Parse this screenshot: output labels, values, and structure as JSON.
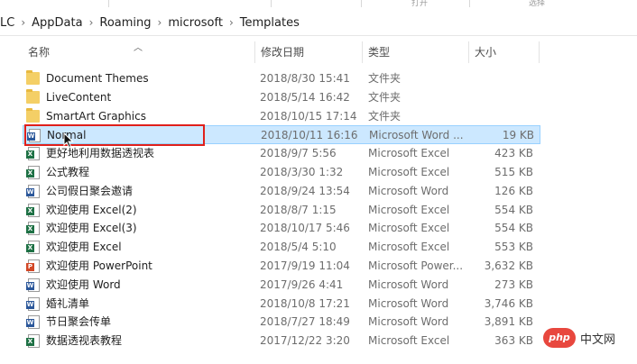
{
  "window": {
    "breadcrumb": [
      "LC",
      "AppData",
      "Roaming",
      "microsoft",
      "Templates"
    ]
  },
  "ribbon": {
    "labels": [
      "打开",
      "选择"
    ]
  },
  "columns": {
    "name": "名称",
    "date": "修改日期",
    "type": "类型",
    "size": "大小"
  },
  "files": [
    {
      "name": "Document Themes",
      "date": "2018/8/30 15:41",
      "type": "文件夹",
      "size": "",
      "icon": "folder-icon"
    },
    {
      "name": "LiveContent",
      "date": "2018/5/14 16:42",
      "type": "文件夹",
      "size": "",
      "icon": "folder-icon"
    },
    {
      "name": "SmartArt Graphics",
      "date": "2018/10/15 17:14",
      "type": "文件夹",
      "size": "",
      "icon": "folder-icon"
    },
    {
      "name": "Normal",
      "date": "2018/10/11 16:16",
      "type": "Microsoft Word ...",
      "size": "19 KB",
      "icon": "word-file-icon"
    },
    {
      "name": "更好地利用数据透视表",
      "date": "2018/9/7 5:56",
      "type": "Microsoft Excel",
      "size": "423 KB",
      "icon": "excel-file-icon"
    },
    {
      "name": "公式教程",
      "date": "2018/3/30 1:32",
      "type": "Microsoft Excel",
      "size": "515 KB",
      "icon": "excel-file-icon"
    },
    {
      "name": "公司假日聚会邀请",
      "date": "2018/9/24 13:54",
      "type": "Microsoft Word",
      "size": "126 KB",
      "icon": "word-file-icon"
    },
    {
      "name": "欢迎使用 Excel(2)",
      "date": "2018/8/7 1:15",
      "type": "Microsoft Excel",
      "size": "554 KB",
      "icon": "excel-file-icon"
    },
    {
      "name": "欢迎使用 Excel(3)",
      "date": "2018/10/17 5:46",
      "type": "Microsoft Excel",
      "size": "554 KB",
      "icon": "excel-file-icon"
    },
    {
      "name": "欢迎使用 Excel",
      "date": "2018/5/4 5:10",
      "type": "Microsoft Excel",
      "size": "553 KB",
      "icon": "excel-file-icon"
    },
    {
      "name": "欢迎使用 PowerPoint",
      "date": "2017/9/19 11:04",
      "type": "Microsoft Power...",
      "size": "3,632 KB",
      "icon": "powerpoint-file-icon"
    },
    {
      "name": "欢迎使用 Word",
      "date": "2017/9/26 4:41",
      "type": "Microsoft Word",
      "size": "273 KB",
      "icon": "word-file-icon"
    },
    {
      "name": "婚礼清单",
      "date": "2018/10/8 17:21",
      "type": "Microsoft Word",
      "size": "3,746 KB",
      "icon": "word-file-icon"
    },
    {
      "name": "节日聚会传单",
      "date": "2018/7/27 18:49",
      "type": "Microsoft Word",
      "size": "3,891 KB",
      "icon": "word-file-icon"
    },
    {
      "name": "数据透视表教程",
      "date": "2017/12/22 3:20",
      "type": "Microsoft Excel",
      "size": "363 KB",
      "icon": "excel-file-icon"
    }
  ],
  "selected_index": 3,
  "watermark": {
    "logo": "php",
    "text": "中文网"
  },
  "colors": {
    "selection": "#cce8ff",
    "highlight_box": "#e0201b",
    "folder": "#f4cf66",
    "excel": "#1e7145",
    "word": "#2b579a",
    "powerpoint": "#d24726"
  }
}
